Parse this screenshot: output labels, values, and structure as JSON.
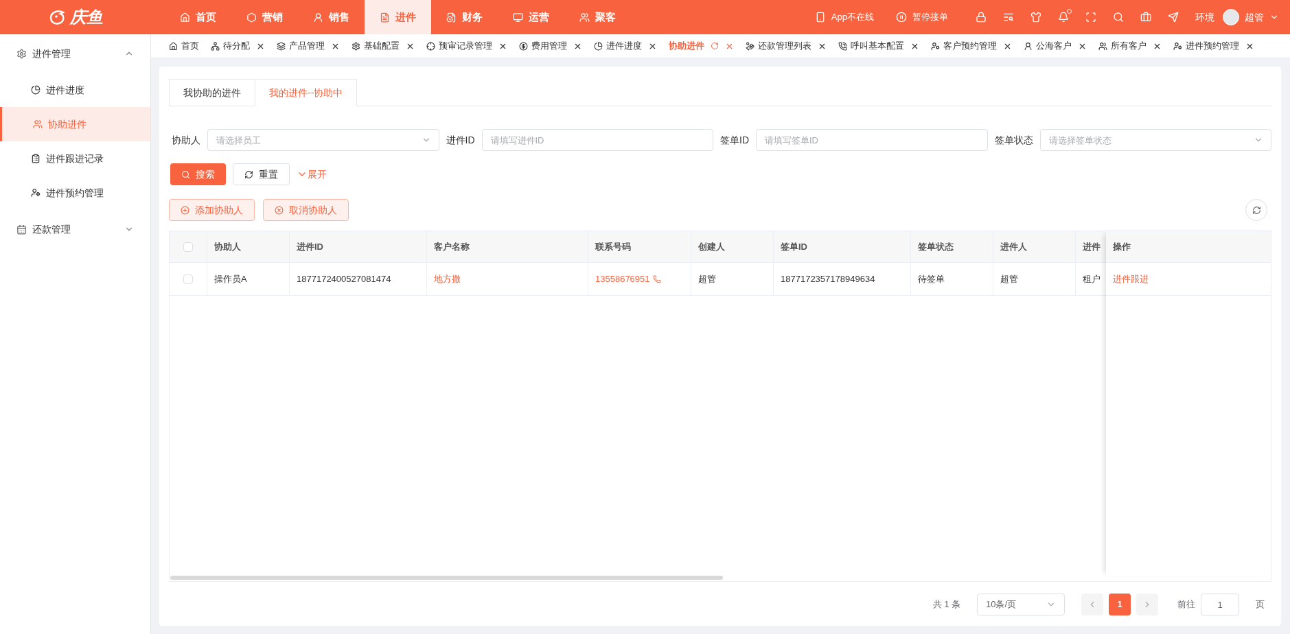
{
  "logo": {
    "text": "庆鱼"
  },
  "nav": [
    {
      "label": "首页",
      "selected": false
    },
    {
      "label": "营销",
      "selected": false
    },
    {
      "label": "销售",
      "selected": false
    },
    {
      "label": "进件",
      "selected": true
    },
    {
      "label": "财务",
      "selected": false
    },
    {
      "label": "运营",
      "selected": false
    },
    {
      "label": "聚客",
      "selected": false
    }
  ],
  "header_right": {
    "app_status": "App不在线",
    "pause": "暂停接单",
    "env": "环境",
    "user": "超管"
  },
  "sidebar": [
    {
      "label": "进件管理",
      "expanded": true,
      "children": [
        {
          "label": "进件进度",
          "selected": false
        },
        {
          "label": "协助进件",
          "selected": true
        },
        {
          "label": "进件跟进记录",
          "selected": false
        },
        {
          "label": "进件预约管理",
          "selected": false
        }
      ]
    },
    {
      "label": "还款管理",
      "expanded": false
    }
  ],
  "page_tabs": [
    {
      "label": "首页",
      "closable": false,
      "selected": false
    },
    {
      "label": "待分配",
      "closable": true,
      "selected": false
    },
    {
      "label": "产品管理",
      "closable": true,
      "selected": false
    },
    {
      "label": "基础配置",
      "closable": true,
      "selected": false
    },
    {
      "label": "预审记录管理",
      "closable": true,
      "selected": false
    },
    {
      "label": "费用管理",
      "closable": true,
      "selected": false
    },
    {
      "label": "进件进度",
      "closable": true,
      "selected": false
    },
    {
      "label": "协助进件",
      "closable": true,
      "selected": true
    },
    {
      "label": "还款管理列表",
      "closable": true,
      "selected": false
    },
    {
      "label": "呼叫基本配置",
      "closable": true,
      "selected": false
    },
    {
      "label": "客户预约管理",
      "closable": true,
      "selected": false
    },
    {
      "label": "公海客户",
      "closable": true,
      "selected": false
    },
    {
      "label": "所有客户",
      "closable": true,
      "selected": false
    },
    {
      "label": "进件预约管理",
      "closable": true,
      "selected": false
    }
  ],
  "sub_tabs": [
    {
      "label": "我协助的进件",
      "selected": false
    },
    {
      "label": "我的进件--协助中",
      "selected": true
    }
  ],
  "filters": [
    {
      "label": "协助人",
      "kind": "select",
      "placeholder": "请选择员工"
    },
    {
      "label": "进件ID",
      "kind": "input",
      "placeholder": "请填写进件ID"
    },
    {
      "label": "签单ID",
      "kind": "input",
      "placeholder": "请填写签单ID"
    },
    {
      "label": "签单状态",
      "kind": "select",
      "placeholder": "请选择签单状态"
    }
  ],
  "search_button": "搜索",
  "reset_button": "重置",
  "expand_link": "展开",
  "actions": [
    {
      "label": "添加协助人"
    },
    {
      "label": "取消协助人"
    }
  ],
  "table": {
    "all_checked": false,
    "columns": [
      "协助人",
      "进件ID",
      "客户名称",
      "联系号码",
      "创建人",
      "签单ID",
      "签单状态",
      "进件人",
      "进件"
    ],
    "fixed_column": "操作",
    "rows": [
      {
        "checked": false,
        "cells": [
          "操作员A",
          "1877172400527081474",
          "地方撒",
          "13558676951",
          "超管",
          "1877172357178949634",
          "待签单",
          "超管",
          "租户"
        ],
        "action": "进件跟进"
      }
    ]
  },
  "pagination": {
    "total": "共 1 条",
    "page_size": "10条/页",
    "pages": [
      {
        "label": "1",
        "selected": true
      }
    ],
    "goto_label": "前往",
    "goto_value": "1",
    "page_suffix": "页"
  }
}
